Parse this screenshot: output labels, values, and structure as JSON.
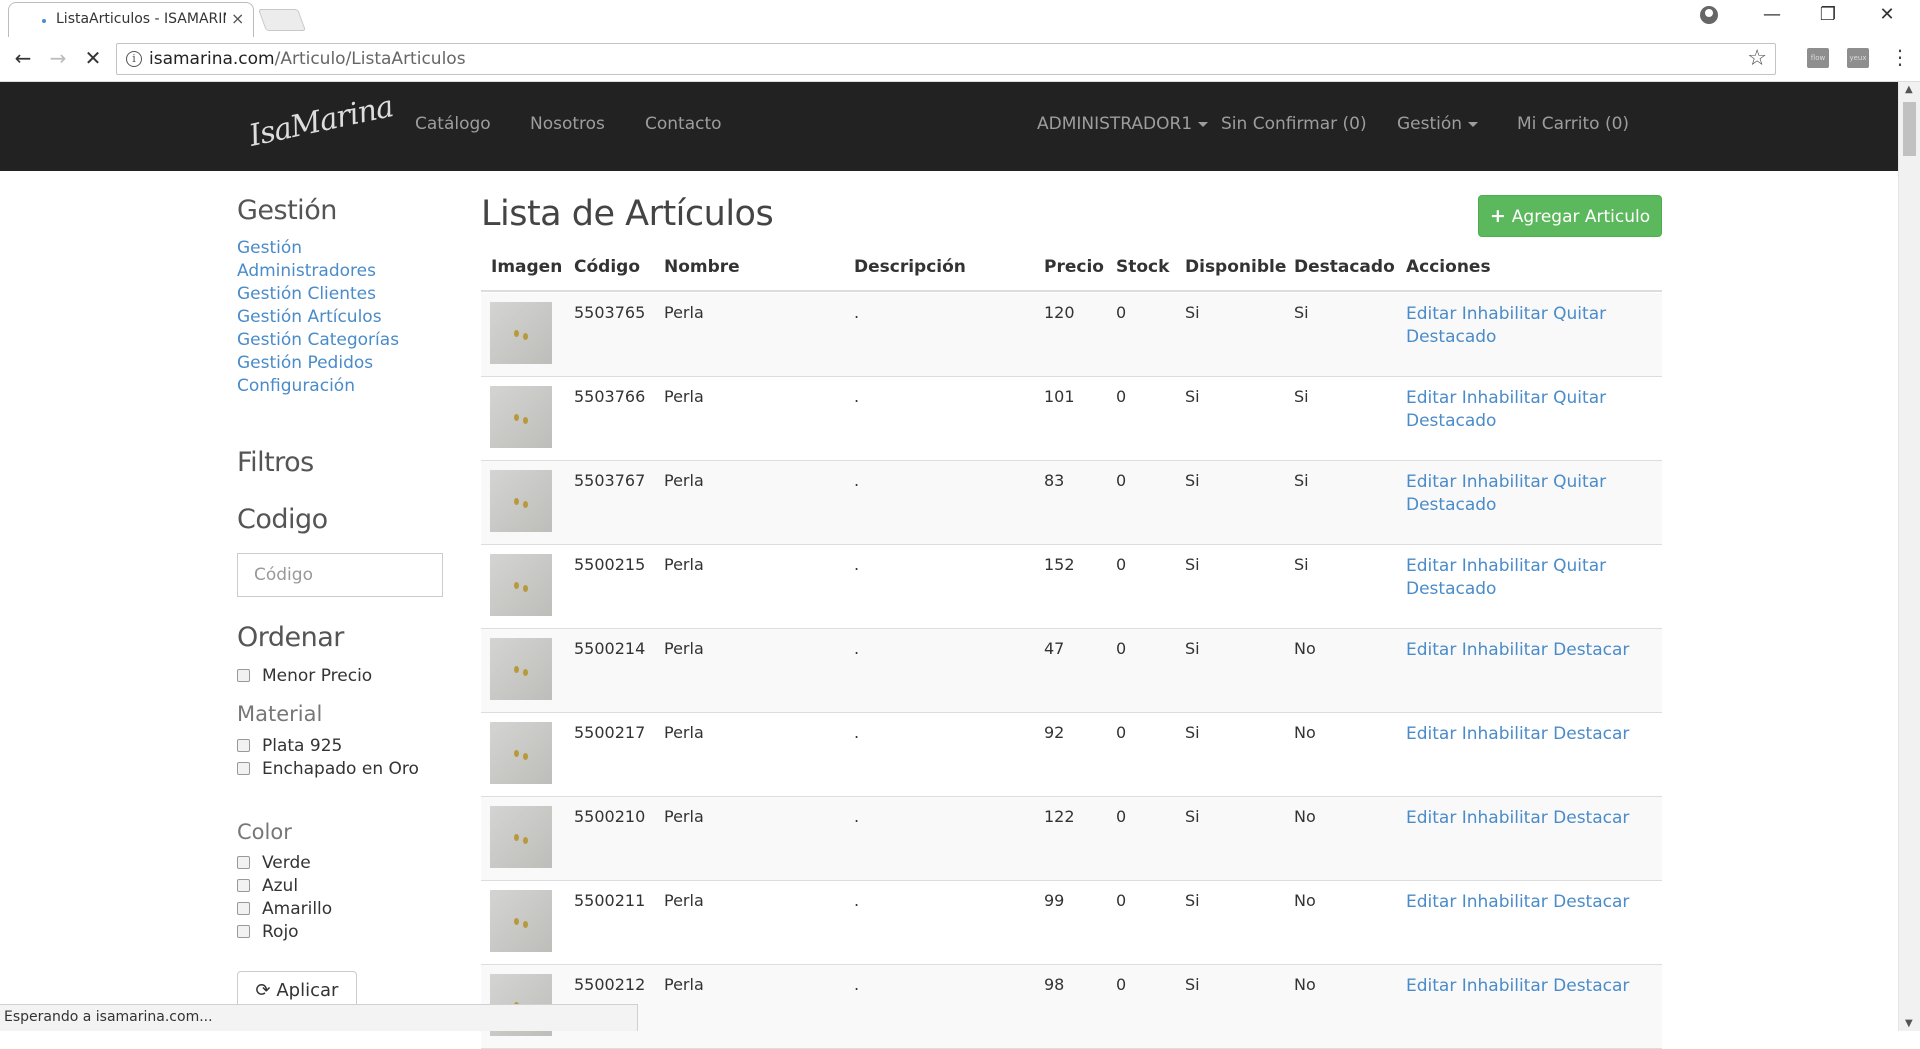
{
  "browser": {
    "tab_title": "ListaArticulos - ISAMARINA",
    "url_host": "isamarina.com",
    "url_path": "/Articulo/ListaArticulos",
    "status_text": "Esperando a isamarina.com..."
  },
  "navbar": {
    "logo_text": "IsaMarina",
    "links": [
      "Catálogo",
      "Nosotros",
      "Contacto"
    ],
    "admin_label": "ADMINISTRADOR1",
    "unconfirmed_label": "Sin Confirmar (0)",
    "management_label": "Gestión",
    "cart_label": "Mi Carrito (0)"
  },
  "sidebar": {
    "management_title": "Gestión",
    "management_links": [
      "Gestión",
      "Administradores",
      "Gestión Clientes",
      "Gestión Artículos",
      "Gestión Categorías",
      "Gestión Pedidos",
      "Configuración"
    ],
    "filters_title": "Filtros",
    "code_title": "Codigo",
    "code_placeholder": "Código",
    "order_title": "Ordenar",
    "order_options": [
      "Menor Precio"
    ],
    "material_title": "Material",
    "material_options": [
      "Plata 925",
      "Enchapado en Oro"
    ],
    "color_title": "Color",
    "color_options": [
      "Verde",
      "Azul",
      "Amarillo",
      "Rojo"
    ],
    "apply_label": "Aplicar"
  },
  "main": {
    "title": "Lista de Artículos",
    "add_button": "Agregar Articulo",
    "headers": [
      "Imagen",
      "Código",
      "Nombre",
      "Descripción",
      "Precio",
      "Stock",
      "Disponible",
      "Destacado",
      "Acciones"
    ],
    "rows": [
      {
        "code": "5503765",
        "name": "Perla",
        "desc": ".",
        "price": "120",
        "stock": "0",
        "available": "Si",
        "featured": "Si",
        "actions": "Editar Inhabilitar Quitar Destacado"
      },
      {
        "code": "5503766",
        "name": "Perla",
        "desc": ".",
        "price": "101",
        "stock": "0",
        "available": "Si",
        "featured": "Si",
        "actions": "Editar Inhabilitar Quitar Destacado"
      },
      {
        "code": "5503767",
        "name": "Perla",
        "desc": ".",
        "price": "83",
        "stock": "0",
        "available": "Si",
        "featured": "Si",
        "actions": "Editar Inhabilitar Quitar Destacado"
      },
      {
        "code": "5500215",
        "name": "Perla",
        "desc": ".",
        "price": "152",
        "stock": "0",
        "available": "Si",
        "featured": "Si",
        "actions": "Editar Inhabilitar Quitar Destacado"
      },
      {
        "code": "5500214",
        "name": "Perla",
        "desc": ".",
        "price": "47",
        "stock": "0",
        "available": "Si",
        "featured": "No",
        "actions": "Editar Inhabilitar Destacar"
      },
      {
        "code": "5500217",
        "name": "Perla",
        "desc": ".",
        "price": "92",
        "stock": "0",
        "available": "Si",
        "featured": "No",
        "actions": "Editar Inhabilitar Destacar"
      },
      {
        "code": "5500210",
        "name": "Perla",
        "desc": ".",
        "price": "122",
        "stock": "0",
        "available": "Si",
        "featured": "No",
        "actions": "Editar Inhabilitar Destacar"
      },
      {
        "code": "5500211",
        "name": "Perla",
        "desc": ".",
        "price": "99",
        "stock": "0",
        "available": "Si",
        "featured": "No",
        "actions": "Editar Inhabilitar Destacar"
      },
      {
        "code": "5500212",
        "name": "Perla",
        "desc": ".",
        "price": "98",
        "stock": "0",
        "available": "Si",
        "featured": "No",
        "actions": "Editar Inhabilitar Destacar"
      }
    ]
  },
  "colors": {
    "navbar_bg": "#222222",
    "link": "#4a8bc9",
    "success": "#5cb85c"
  }
}
